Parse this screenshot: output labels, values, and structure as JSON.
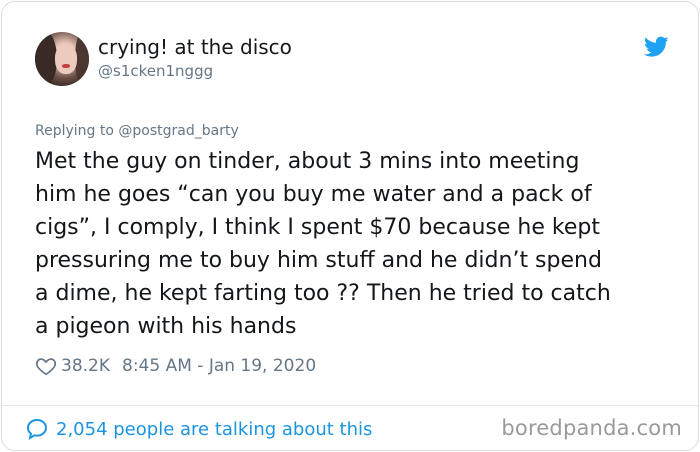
{
  "tweet": {
    "display_name": "crying! at the disco",
    "handle": "@s1cken1nggg",
    "replying_prefix": "Replying to",
    "replying_to": "@postgrad_barty",
    "lines": [
      "Met the guy on tinder, about 3 mins into meeting",
      "him he goes “can you buy me water and a pack of",
      "cigs”, I comply, I think I spent $70 because he kept",
      "pressuring me to buy him stuff and he didn’t spend",
      "a dime, he kept farting too ?? Then he tried to catch",
      "a pigeon with his hands"
    ],
    "likes": "38.2K",
    "timestamp": "8:45 AM - Jan 19, 2020",
    "talking": "2,054 people are talking about this"
  },
  "watermark": "boredpanda.com",
  "icons": {
    "brand": "twitter-bird-icon",
    "like": "heart-icon",
    "talk": "speech-bubble-icon"
  },
  "colors": {
    "twitter_blue": "#1da1f2",
    "link_blue": "#1b95e0",
    "text": "#14171a",
    "muted": "#657786"
  }
}
